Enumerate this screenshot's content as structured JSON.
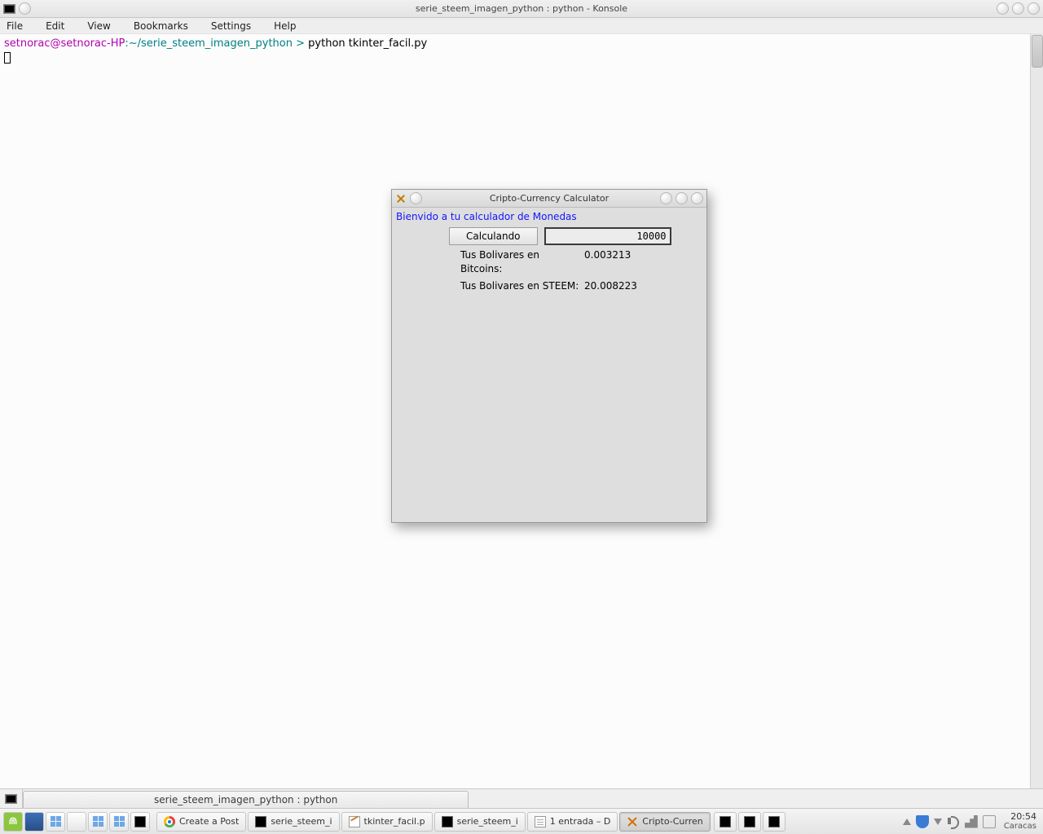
{
  "window": {
    "title": "serie_steem_imagen_python : python - Konsole"
  },
  "menu": {
    "file": "File",
    "edit": "Edit",
    "view": "View",
    "bookmarks": "Bookmarks",
    "settings": "Settings",
    "help": "Help"
  },
  "terminal": {
    "user": "setnorac@setnorac-HP",
    "path": "~/serie_steem_imagen_python",
    "sep": ":",
    "gt": " > ",
    "cmd": "python tkinter_facil.py"
  },
  "konsole_tab": "serie_steem_imagen_python : python",
  "dialog": {
    "title": "Cripto-Currency Calculator",
    "welcome": "Bienvido a tu calculador de Monedas",
    "button": "Calculando",
    "entry_value": "10000",
    "rows": [
      {
        "label": "Tus Bolivares en Bitcoins:",
        "value": "0.003213"
      },
      {
        "label": "Tus Bolivares en STEEM:",
        "value": "20.008223"
      }
    ]
  },
  "taskbar": {
    "items": [
      {
        "label": "Create a Post",
        "icon": "chrome"
      },
      {
        "label": "serie_steem_i",
        "icon": "term"
      },
      {
        "label": "tkinter_facil.p",
        "icon": "gedit"
      },
      {
        "label": "serie_steem_i",
        "icon": "term"
      },
      {
        "label": "1 entrada – D",
        "icon": "doc"
      },
      {
        "label": "Cripto-Curren",
        "icon": "x",
        "active": true
      }
    ],
    "term_only_count": 3,
    "clock_time": "20:54",
    "clock_zone": "Caracas"
  }
}
